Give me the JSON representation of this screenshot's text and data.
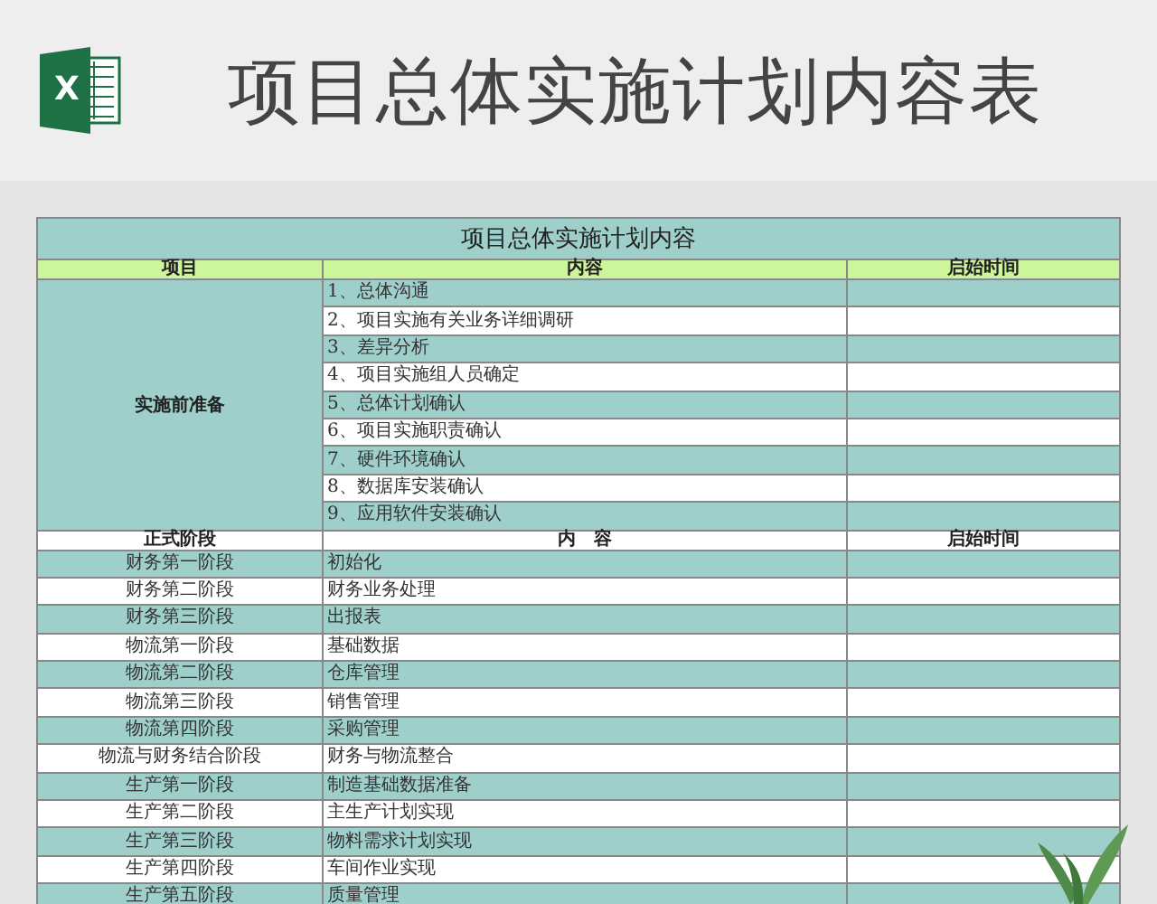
{
  "app_icon": {
    "letter": "X"
  },
  "page_title": "项目总体实施计划内容表",
  "sheet": {
    "title": "项目总体实施计划内容",
    "sections": [
      {
        "kind": "merged",
        "columns": [
          "项目",
          "内容",
          "启始时间"
        ],
        "group": "实施前准备",
        "items": [
          "1、总体沟通",
          "2、项目实施有关业务详细调研",
          "3、差异分析",
          "4、项目实施组人员确定",
          "5、总体计划确认",
          "6、项目实施职责确认",
          "7、硬件环境确认",
          "8、数据库安装确认",
          "9、应用软件安装确认"
        ]
      },
      {
        "kind": "list",
        "columns": [
          "正式阶段",
          "内　容",
          "启始时间"
        ],
        "rows": [
          {
            "stage": "财务第一阶段",
            "content": "初始化"
          },
          {
            "stage": "财务第二阶段",
            "content": "财务业务处理"
          },
          {
            "stage": "财务第三阶段",
            "content": "出报表"
          },
          {
            "stage": "物流第一阶段",
            "content": "基础数据"
          },
          {
            "stage": "物流第二阶段",
            "content": "仓库管理"
          },
          {
            "stage": "物流第三阶段",
            "content": "销售管理"
          },
          {
            "stage": "物流第四阶段",
            "content": "采购管理"
          },
          {
            "stage": "物流与财务结合阶段",
            "content": "财务与物流整合"
          },
          {
            "stage": "生产第一阶段",
            "content": "制造基础数据准备"
          },
          {
            "stage": "生产第二阶段",
            "content": "主生产计划实现"
          },
          {
            "stage": "生产第三阶段",
            "content": "物料需求计划实现"
          },
          {
            "stage": "生产第四阶段",
            "content": "车间作业实现"
          },
          {
            "stage": "生产第五阶段",
            "content": "质量管理"
          }
        ]
      }
    ]
  }
}
